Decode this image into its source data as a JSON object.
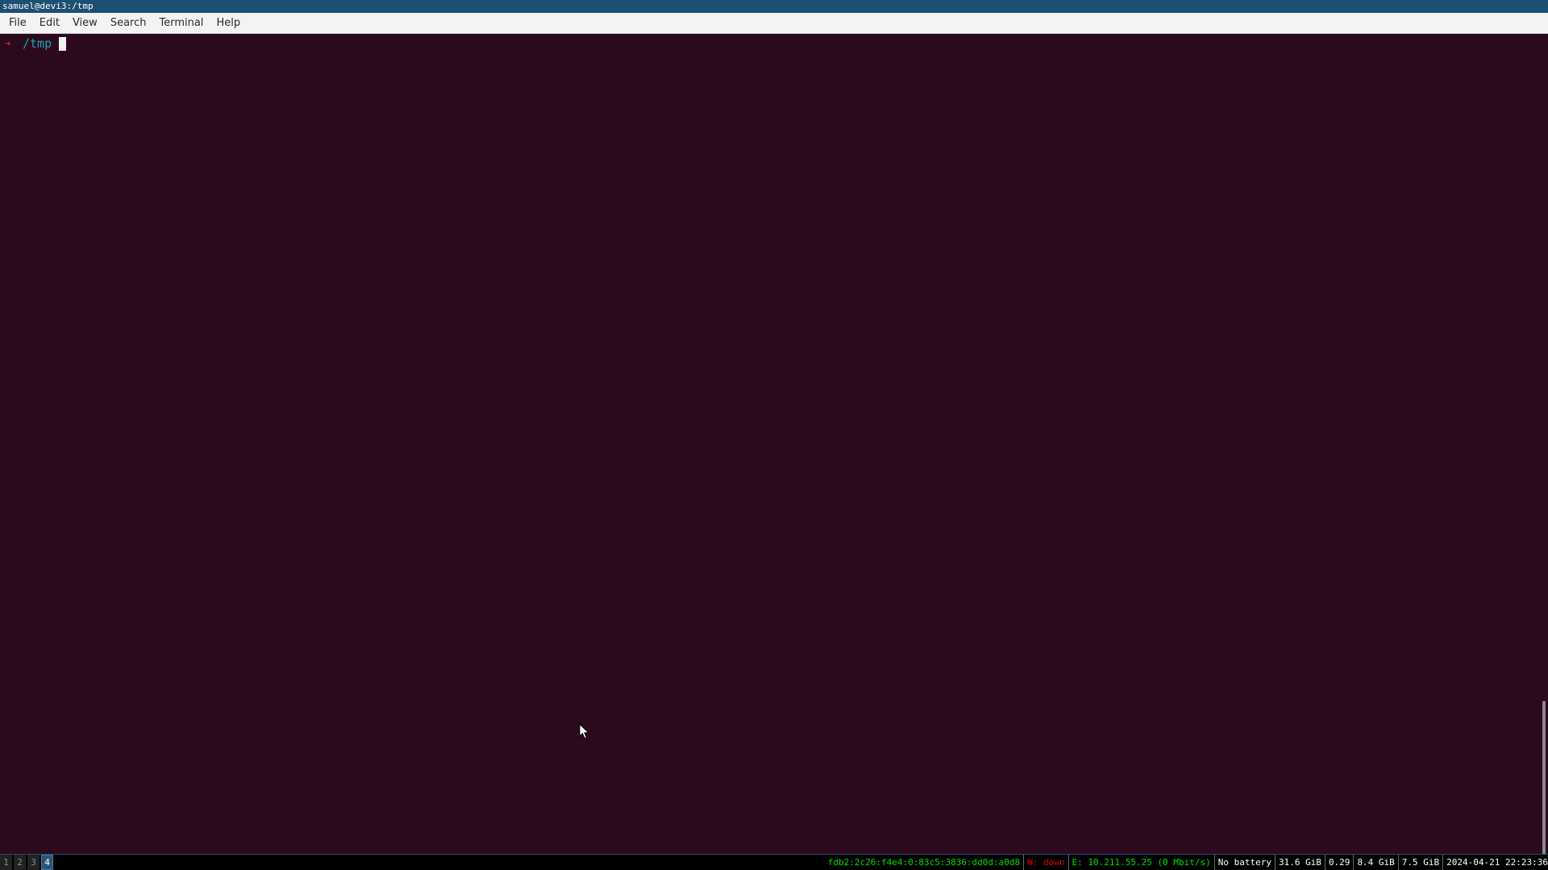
{
  "window": {
    "title": "samuel@devi3:/tmp"
  },
  "menubar": {
    "items": [
      "File",
      "Edit",
      "View",
      "Search",
      "Terminal",
      "Help"
    ]
  },
  "terminal": {
    "prompt_symbol": "➜",
    "cwd": "/tmp",
    "cursor_icon": "block-cursor-icon"
  },
  "statusbar": {
    "workspaces": [
      "1",
      "2",
      "3",
      "4"
    ],
    "active_workspace": "4",
    "ipv6": "fdb2:2c26:f4e4:0:83c5:3836:dd0d:a0d8",
    "wireless": "W: down",
    "ethernet": "E: 10.211.55.25 (0 Mbit/s)",
    "battery": "No battery",
    "disk": "31.6 GiB",
    "load": "0.29",
    "memory_used": "8.4 GiB",
    "memory_total": "7.5 GiB",
    "datetime": "2024-04-21 22:23:36"
  },
  "colors": {
    "terminal_bg": "#2c0a1e",
    "titlebar_bg": "#1d4f73",
    "prompt_arrow": "#e02424",
    "prompt_path": "#19a3b4",
    "status_good": "#00e000",
    "status_bad": "#e00000"
  }
}
